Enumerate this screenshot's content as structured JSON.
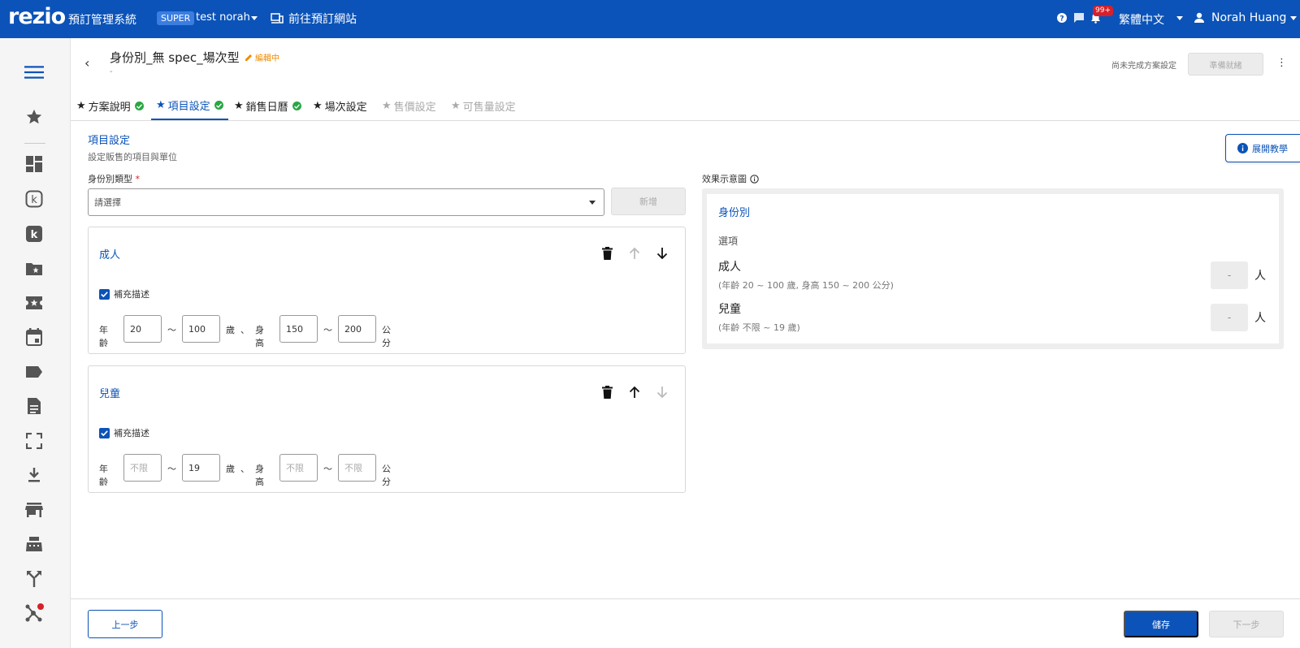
{
  "topbar": {
    "logo": "rezio",
    "system_name": "預訂管理系統",
    "super_badge": "SUPER",
    "account_name": "test norah",
    "site_link": "前往預訂網站",
    "notification_count": "99+",
    "language": "繁體中文",
    "user_name": "Norah Huang"
  },
  "sidebar": {
    "icons": [
      "menu-icon",
      "star-icon",
      "dashboard-icon",
      "k-outline-icon",
      "k-filled-icon",
      "folder-star-icon",
      "ticket-star-icon",
      "calendar-icon",
      "label-icon",
      "document-icon",
      "fullscreen-icon",
      "download-icon",
      "store-icon",
      "cash-register-icon",
      "merge-icon",
      "network-icon"
    ]
  },
  "header": {
    "title": "身份別_無 spec_場次型",
    "edit_status": "編輯中",
    "subtitle": "-",
    "incomplete_text": "尚未完成方案設定",
    "ready_button": "準備就緒"
  },
  "tabs": [
    {
      "label": "方案說明",
      "done": true,
      "state": "normal"
    },
    {
      "label": "項目設定",
      "done": true,
      "state": "active"
    },
    {
      "label": "銷售日曆",
      "done": true,
      "state": "normal"
    },
    {
      "label": "場次設定",
      "done": false,
      "state": "normal"
    },
    {
      "label": "售價設定",
      "done": false,
      "state": "disabled"
    },
    {
      "label": "可售量設定",
      "done": false,
      "state": "disabled"
    }
  ],
  "section": {
    "title": "項目設定",
    "description": "設定販售的項目與單位",
    "tutorial_button": "展開教學",
    "type_label": "身份別類型",
    "required_mark": "*",
    "select_placeholder": "請選擇",
    "add_button": "新增"
  },
  "cards": [
    {
      "name": "成人",
      "supplement_label": "補充描述",
      "supplement_checked": true,
      "age_label": "年齡",
      "age_min": "20",
      "age_max": "100",
      "age_unit": "歲",
      "separator": "、",
      "height_label": "身高",
      "height_min": "150",
      "height_max": "200",
      "height_unit": "公分",
      "tilde": "～"
    },
    {
      "name": "兒童",
      "supplement_label": "補充描述",
      "supplement_checked": true,
      "age_label": "年齡",
      "age_min_placeholder": "不限",
      "age_max": "19",
      "age_unit": "歲",
      "separator": "、",
      "height_label": "身高",
      "height_min_placeholder": "不限",
      "height_max_placeholder": "不限",
      "height_unit": "公分",
      "tilde": "～"
    }
  ],
  "preview": {
    "label": "效果示意圖",
    "title": "身份別",
    "options_label": "選項",
    "items": [
      {
        "name": "成人",
        "desc": "(年齡 20 ~ 100 歲, 身高 150 ~ 200 公分)",
        "qty": "-",
        "unit": "人"
      },
      {
        "name": "兒童",
        "desc": "(年齡 不限 ~ 19 歲)",
        "qty": "-",
        "unit": "人"
      }
    ]
  },
  "footer": {
    "prev_button": "上一步",
    "save_button": "儲存",
    "next_button": "下一步"
  },
  "colors": {
    "primary": "#0b53b8",
    "success": "#29a745",
    "warning": "#f08a00",
    "danger": "#d6202b"
  }
}
